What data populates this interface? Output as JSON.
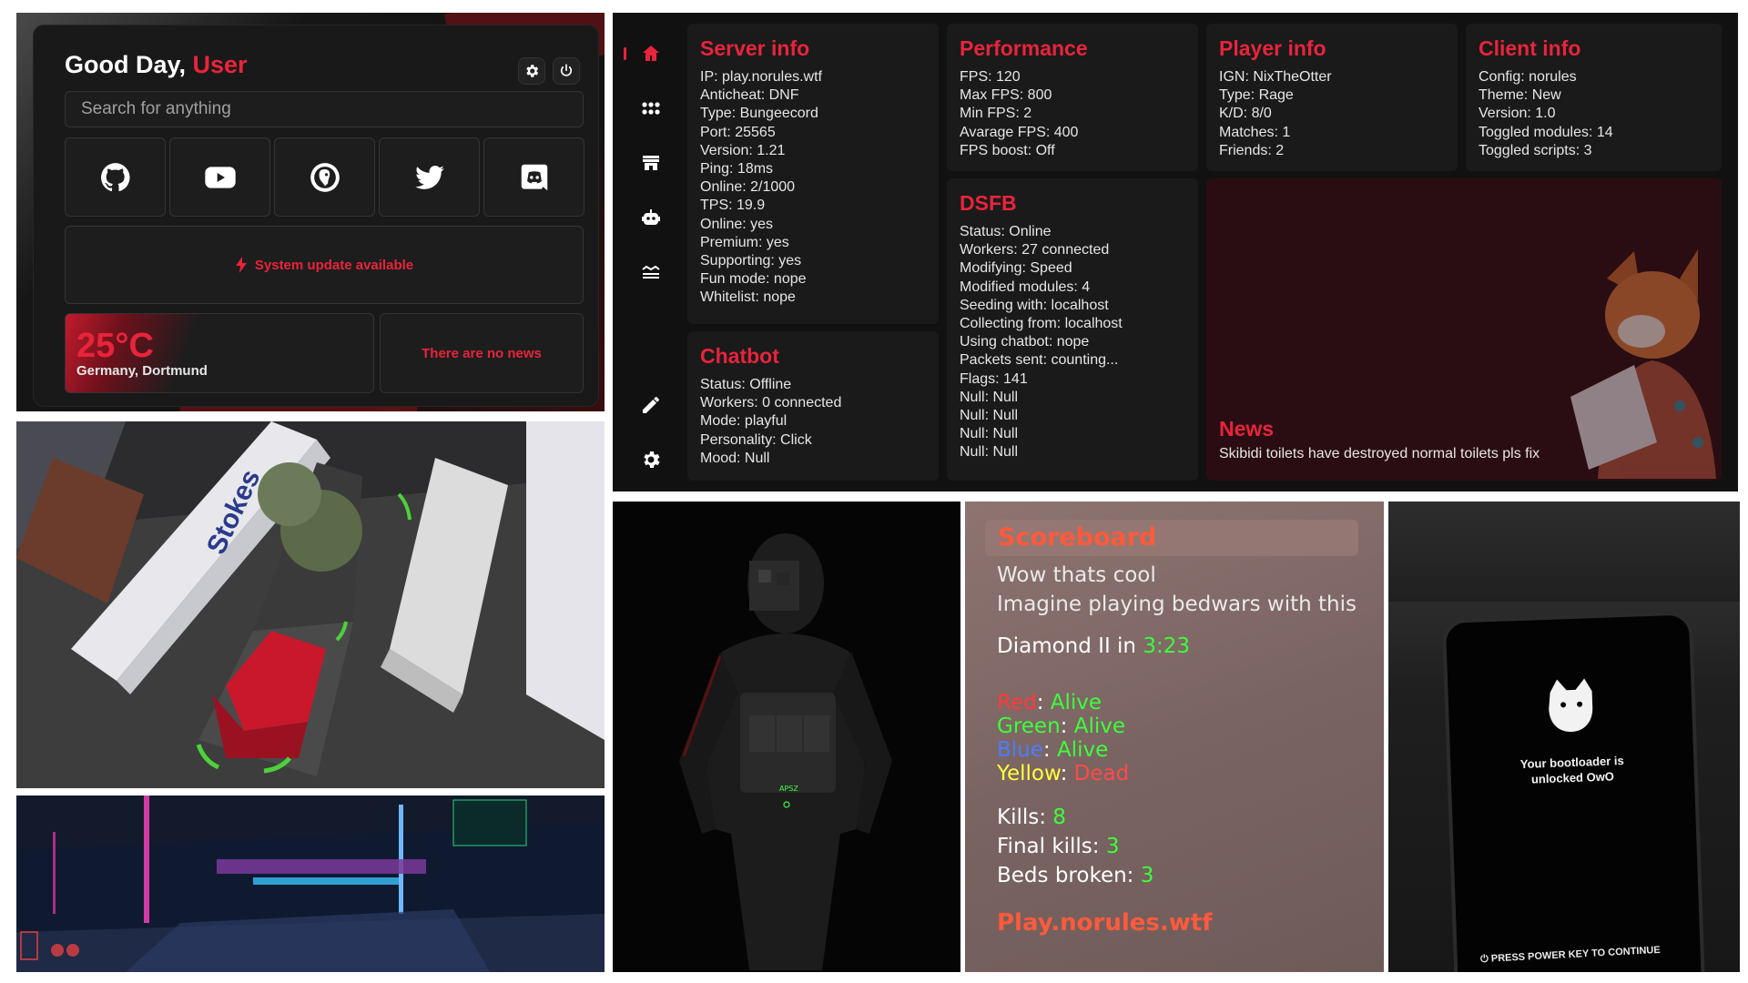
{
  "start_page": {
    "greeting": "Good Day,",
    "user": "User",
    "search_placeholder": "Search for anything",
    "social_icons": [
      "github-icon",
      "youtube-icon",
      "duckduckgo-icon",
      "twitter-icon",
      "discord-icon"
    ],
    "update_text": "System update available",
    "weather": {
      "temperature": "25°C",
      "location": "Germany, Dortmund"
    },
    "news_text": "There are no news"
  },
  "dashboard": {
    "sidebar": [
      "home-icon",
      "apps-icon",
      "store-icon",
      "robot-icon",
      "layers-icon",
      "edit-icon",
      "settings-icon"
    ],
    "server_info": {
      "title": "Server info",
      "lines": [
        "IP: play.norules.wtf",
        "Anticheat: DNF",
        "Type: Bungeecord",
        "Port: 25565",
        "Version: 1.21",
        "Ping: 18ms",
        "Online: 2/1000",
        "TPS: 19.9",
        "Online: yes",
        "Premium: yes",
        "Supporting: yes",
        "Fun mode: nope",
        "Whitelist: nope"
      ]
    },
    "performance": {
      "title": "Performance",
      "lines": [
        "FPS: 120",
        "Max FPS: 800",
        "Min FPS: 2",
        "Avarage FPS: 400",
        "FPS boost: Off"
      ]
    },
    "player_info": {
      "title": "Player info",
      "lines": [
        "IGN: NixTheOtter",
        "Type: Rage",
        "K/D: 8/0",
        "Matches: 1",
        "Friends: 2"
      ]
    },
    "client_info": {
      "title": "Client info",
      "lines": [
        "Config: norules",
        "Theme: New",
        "Version: 1.0",
        "Toggled modules: 14",
        "Toggled scripts: 3"
      ]
    },
    "dsfb": {
      "title": "DSFB",
      "lines": [
        "Status: Online",
        "Workers: 27 connected",
        "Modifying: Speed",
        "Modified modules: 4",
        "Seeding with: localhost",
        "Collecting from: localhost",
        "Using chatbot: nope",
        "Packets sent: counting...",
        "Flags: 141",
        "Null: Null",
        "Null: Null",
        "Null: Null",
        "Null: Null"
      ]
    },
    "chatbot": {
      "title": "Chatbot",
      "lines": [
        "Status: Offline",
        "Workers: 0 connected",
        "Mode: playful",
        "Personality: Click",
        "Mood: Null"
      ]
    },
    "news": {
      "title": "News",
      "text": "Skibidi toilets have destroyed normal toilets pls fix"
    }
  },
  "scoreboard": {
    "title": "Scoreboard",
    "line1": "Wow thats cool",
    "line2": "Imagine playing bedwars with this",
    "diamond_prefix": "Diamond II in ",
    "diamond_time": "3:23",
    "teams": [
      {
        "name": "Red",
        "status": "Alive",
        "name_color": "#ff3b3b",
        "status_color": "#3cff3c"
      },
      {
        "name": "Green",
        "status": "Alive",
        "name_color": "#3cff3c",
        "status_color": "#3cff3c"
      },
      {
        "name": "Blue",
        "status": "Alive",
        "name_color": "#4a7dff",
        "status_color": "#3cff3c"
      },
      {
        "name": "Yellow",
        "status": "Dead",
        "name_color": "#ffff3c",
        "status_color": "#ff4a4a"
      }
    ],
    "kills_label": "Kills: ",
    "kills": "8",
    "final_kills_label": "Final kills: ",
    "final_kills": "3",
    "beds_label": "Beds broken: ",
    "beds": "3",
    "server": "Play.norules.wtf"
  },
  "character": {
    "tag": "APSZ"
  },
  "phone": {
    "line1": "Your bootloader is",
    "line2": "unlocked OwO",
    "footer": "PRESS POWER KEY TO CONTINUE"
  },
  "truck": {
    "trailer_brand": "Stokes"
  },
  "colors": {
    "accent": "#e8243b",
    "panel": "#1a1a1a",
    "background": "#111111"
  }
}
